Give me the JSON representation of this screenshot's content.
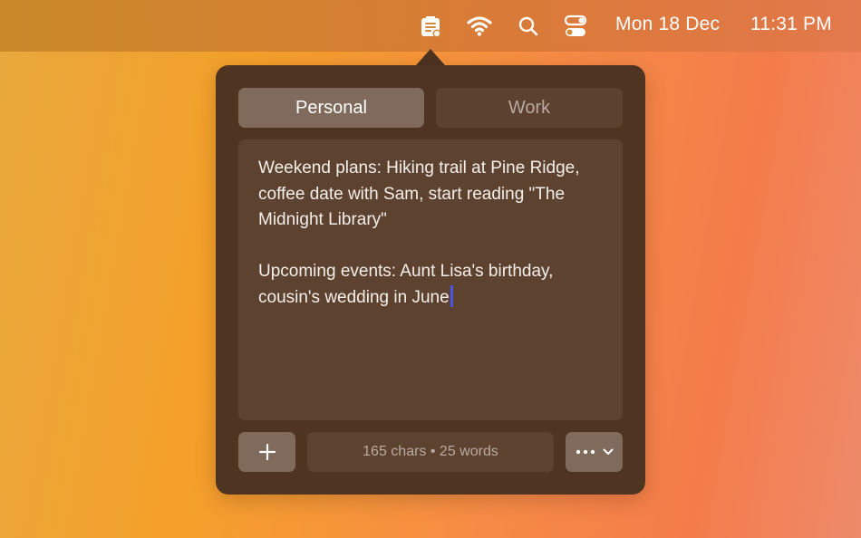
{
  "menubar": {
    "date": "Mon 18 Dec",
    "time": "11:31 PM",
    "icons": [
      "notes-app-icon",
      "wifi-icon",
      "search-icon",
      "control-center-icon"
    ]
  },
  "popover": {
    "tabs": [
      {
        "label": "Personal",
        "active": true
      },
      {
        "label": "Work",
        "active": false
      }
    ],
    "note": {
      "paragraph1": "Weekend plans: Hiking trail at Pine Ridge,\ncoffee date with Sam, start reading \"The\nMidnight Library\"",
      "paragraph2": "Upcoming events: Aunt Lisa's birthday,\ncousin's wedding in June"
    },
    "footer": {
      "add_icon": "plus-icon",
      "stats": "165 chars • 25 words",
      "more_icon": "ellipsis-icon",
      "dropdown_icon": "chevron-down-icon"
    }
  },
  "colors": {
    "popover_bg": "#4e3421",
    "active_tab": "#7f6a5b",
    "editor_bg": "#5d4230",
    "caret": "#4b55e0"
  }
}
